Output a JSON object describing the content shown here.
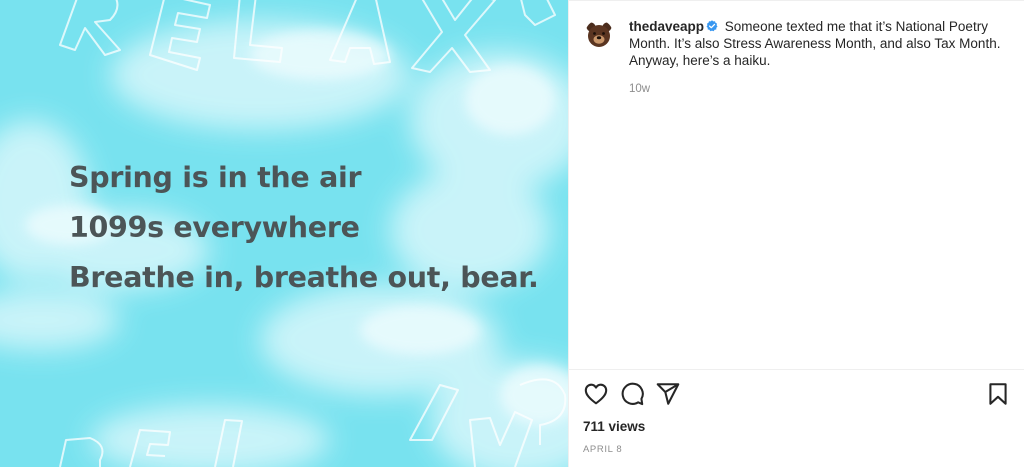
{
  "media": {
    "haiku_lines": [
      "Spring is in the air",
      "1099s everywhere",
      "Breathe in, breathe out, bear."
    ],
    "bg_color": "#79e3f0",
    "text_color": "#4c5557"
  },
  "post": {
    "username": "thedaveapp",
    "verified_icon": "verified-badge-icon",
    "caption": "Someone texted me that it’s National Poetry Month. It’s also Stress Awareness Month, and also Tax Month. Anyway, here’s a haiku.",
    "caption_time": "10w",
    "views": "711 views",
    "date": "APRIL 8"
  },
  "actions": {
    "like_icon": "heart-icon",
    "comment_icon": "comment-icon",
    "share_icon": "paper-plane-icon",
    "save_icon": "bookmark-icon"
  },
  "colors": {
    "text": "#262626",
    "muted": "#8e8e8e",
    "verified": "#3897f0",
    "divider": "#efefef"
  }
}
